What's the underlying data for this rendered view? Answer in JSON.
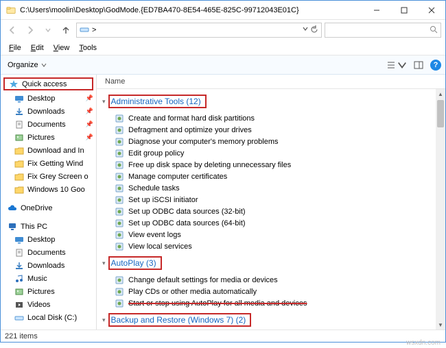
{
  "window": {
    "title": "C:\\Users\\moolin\\Desktop\\GodMode.{ED7BA470-8E54-465E-825C-99712043E01C}"
  },
  "breadcrumb": ">",
  "search_placeholder": "",
  "menu": {
    "file": "File",
    "edit": "Edit",
    "view": "View",
    "tools": "Tools"
  },
  "toolbar": {
    "organize": "Organize"
  },
  "columns": {
    "name": "Name"
  },
  "sidebar": {
    "quick": "Quick access",
    "items1": [
      {
        "label": "Desktop",
        "pin": true
      },
      {
        "label": "Downloads",
        "pin": true
      },
      {
        "label": "Documents",
        "pin": true
      },
      {
        "label": "Pictures",
        "pin": true
      },
      {
        "label": "Download and In"
      },
      {
        "label": "Fix Getting Wind"
      },
      {
        "label": "Fix Grey Screen o"
      },
      {
        "label": "Windows 10 Goo"
      }
    ],
    "onedrive": "OneDrive",
    "thispc": "This PC",
    "items2": [
      {
        "label": "Desktop"
      },
      {
        "label": "Documents"
      },
      {
        "label": "Downloads"
      },
      {
        "label": "Music"
      },
      {
        "label": "Pictures"
      },
      {
        "label": "Videos"
      },
      {
        "label": "Local Disk (C:)"
      }
    ]
  },
  "groups": [
    {
      "header": "Administrative Tools (12)",
      "items": [
        "Create and format hard disk partitions",
        "Defragment and optimize your drives",
        "Diagnose your computer's memory problems",
        "Edit group policy",
        "Free up disk space by deleting unnecessary files",
        "Manage computer certificates",
        "Schedule tasks",
        "Set up iSCSI initiator",
        "Set up ODBC data sources (32-bit)",
        "Set up ODBC data sources (64-bit)",
        "View event logs",
        "View local services"
      ]
    },
    {
      "header": "AutoPlay (3)",
      "items": [
        "Change default settings for media or devices",
        "Play CDs or other media automatically",
        "Start or stop using AutoPlay for all media and devices"
      ]
    },
    {
      "header": "Backup and Restore (Windows 7) (2)",
      "items": []
    }
  ],
  "status": {
    "count": "221 items"
  },
  "watermark": "wsxdn.com"
}
